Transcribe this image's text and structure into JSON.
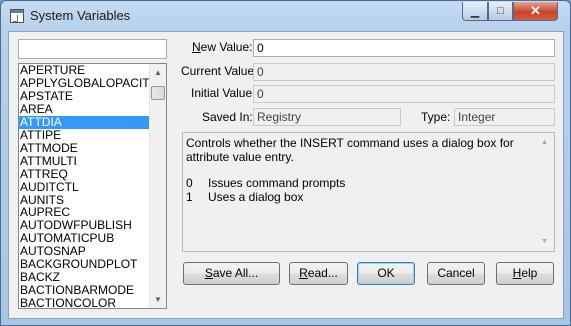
{
  "window": {
    "title": "System Variables",
    "controls": {
      "minimize": "▁",
      "maximize": "□",
      "close": "✕"
    }
  },
  "search": {
    "value": ""
  },
  "variables": {
    "items": [
      "APERTURE",
      "APPLYGLOBALOPACITIES",
      "APSTATE",
      "AREA",
      "ATTDIA",
      "ATTIPE",
      "ATTMODE",
      "ATTMULTI",
      "ATTREQ",
      "AUDITCTL",
      "AUNITS",
      "AUPREC",
      "AUTODWFPUBLISH",
      "AUTOMATICPUB",
      "AUTOSNAP",
      "BACKGROUNDPLOT",
      "BACKZ",
      "BACTIONBARMODE",
      "BACTIONCOLOR"
    ],
    "selected": "ATTDIA"
  },
  "fields": {
    "new_value": {
      "label_accel": "N",
      "label_rest": "ew Value:",
      "value": "0"
    },
    "current_value": {
      "label": "Current Value:",
      "value": "0"
    },
    "initial_value": {
      "label": "Initial Value:",
      "value": "0"
    },
    "saved_in": {
      "label": "Saved In:",
      "value": "Registry"
    },
    "type": {
      "label": "Type:",
      "value": "Integer"
    }
  },
  "description": {
    "text": "Controls whether the INSERT command uses a dialog box for attribute value entry.",
    "options": [
      {
        "key": "0",
        "text": "Issues command prompts"
      },
      {
        "key": "1",
        "text": "Uses a dialog box"
      }
    ]
  },
  "buttons": {
    "save_all": {
      "accel": "S",
      "rest": "ave All..."
    },
    "read": {
      "accel": "R",
      "rest": "ead..."
    },
    "ok": {
      "label": "OK"
    },
    "cancel": {
      "label": "Cancel"
    },
    "help": {
      "accel": "H",
      "rest": "elp"
    }
  }
}
